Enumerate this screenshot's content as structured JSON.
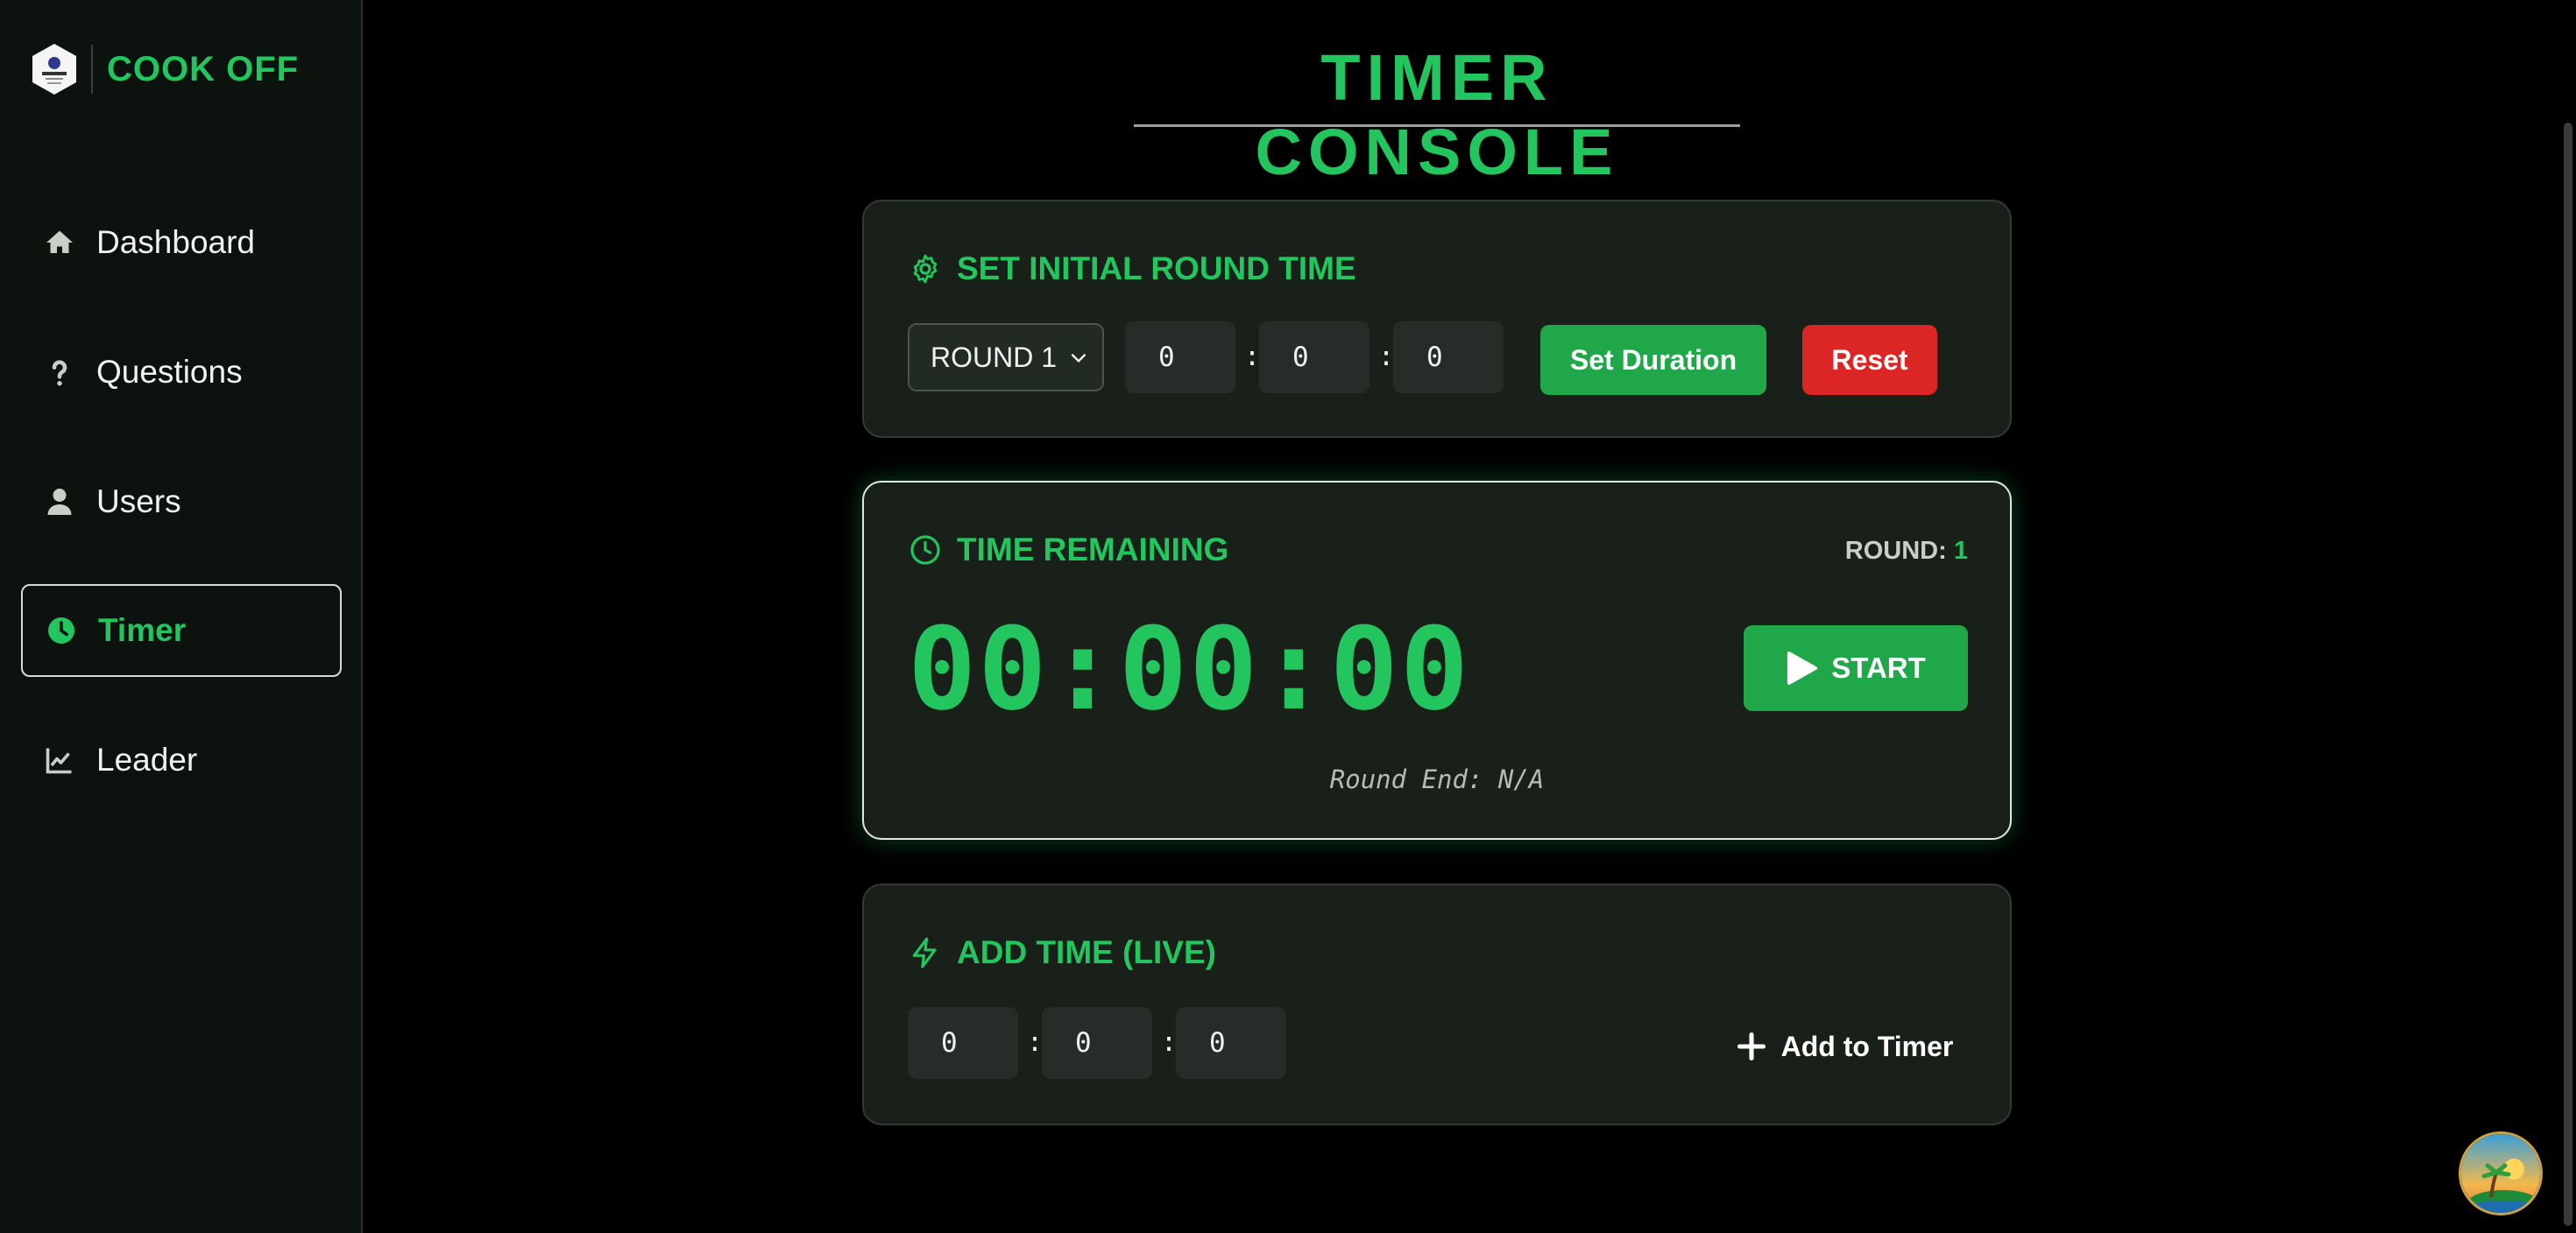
{
  "brand": {
    "name": "COOK OFF"
  },
  "sidebar": {
    "items": [
      {
        "label": "Dashboard",
        "icon": "home-icon"
      },
      {
        "label": "Questions",
        "icon": "question-icon"
      },
      {
        "label": "Users",
        "icon": "user-icon"
      },
      {
        "label": "Timer",
        "icon": "clock-icon",
        "active": true
      },
      {
        "label": "Leader",
        "icon": "chart-line-icon"
      }
    ]
  },
  "page": {
    "title": "TIMER CONSOLE"
  },
  "set_round": {
    "heading": "SET INITIAL ROUND TIME",
    "heading_icon": "gear-icon",
    "round_select": "ROUND 1",
    "hours": "0",
    "minutes": "0",
    "seconds": "0",
    "separator": ":",
    "set_label": "Set Duration",
    "reset_label": "Reset"
  },
  "remaining": {
    "heading": "TIME REMAINING",
    "heading_icon": "clock-icon",
    "round_label": "ROUND:",
    "round_value": "1",
    "time": "00:00:00",
    "start_label": "START",
    "start_icon": "play-icon",
    "round_end": "Round End: N/A"
  },
  "add_time": {
    "heading": "ADD TIME (LIVE)",
    "heading_icon": "bolt-icon",
    "hours": "0",
    "minutes": "0",
    "seconds": "0",
    "separator": ":",
    "add_label": "Add to Timer",
    "add_icon": "plus-icon"
  },
  "colors": {
    "accent": "#22c55e",
    "danger": "#dc2626",
    "card_bg": "#182019",
    "sidebar_bg": "#0c130f"
  }
}
